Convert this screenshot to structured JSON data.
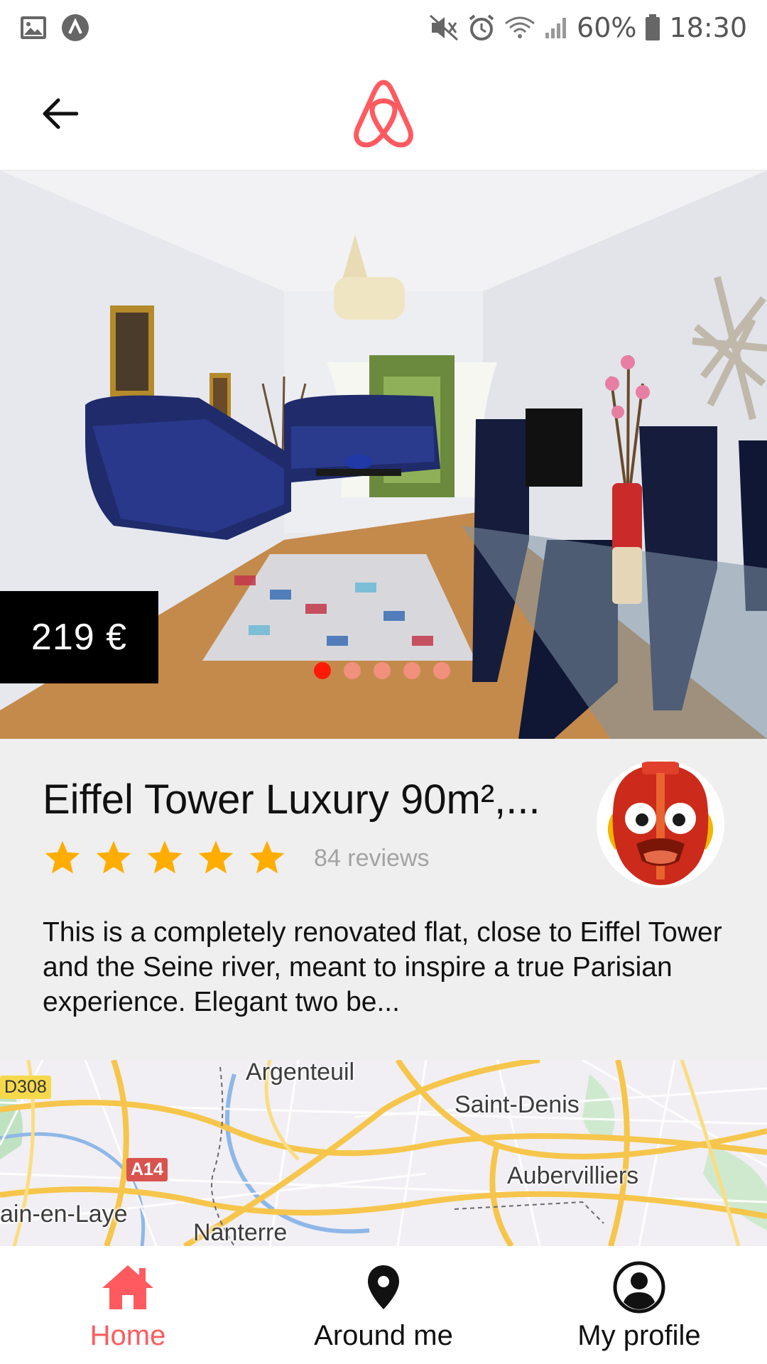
{
  "status_bar": {
    "battery": "60%",
    "time": "18:30",
    "icons": [
      "gallery-icon",
      "app-notification-icon",
      "mute-icon",
      "alarm-icon",
      "wifi-icon",
      "signal-icon",
      "battery-icon"
    ]
  },
  "header": {
    "back_icon": "back-arrow-icon",
    "logo": "airbnb-logo"
  },
  "listing": {
    "price": "219 €",
    "carousel": {
      "total": 5,
      "active_index": 0
    },
    "title": "Eiffel Tower Luxury 90m²,...",
    "rating": 5,
    "rating_max": 5,
    "review_count": "84 reviews",
    "description": "This is a completely renovated flat, close to Eiffel Tower and the Seine river, meant to inspire a true Parisian experience. Elegant two be..."
  },
  "map": {
    "labels": {
      "argenteuil": "Argenteuil",
      "saint_denis": "Saint-Denis",
      "aubervilliers": "Aubervilliers",
      "saint_germain": "ain-en-Laye",
      "nanterre": "Nanterre"
    },
    "roads": {
      "d308": "D308",
      "a14": "A14"
    }
  },
  "bottom_nav": {
    "items": [
      {
        "label": "Home",
        "icon": "home-icon",
        "active": true
      },
      {
        "label": "Around me",
        "icon": "location-pin-icon",
        "active": false
      },
      {
        "label": "My profile",
        "icon": "profile-icon",
        "active": false
      }
    ]
  },
  "colors": {
    "brand": "#ff5a5f",
    "star": "#ffad00",
    "dot_active": "#ff1a0a",
    "dot_inactive": "#f2907e",
    "info_bg": "#efeff0",
    "price_bg": "#000000"
  }
}
